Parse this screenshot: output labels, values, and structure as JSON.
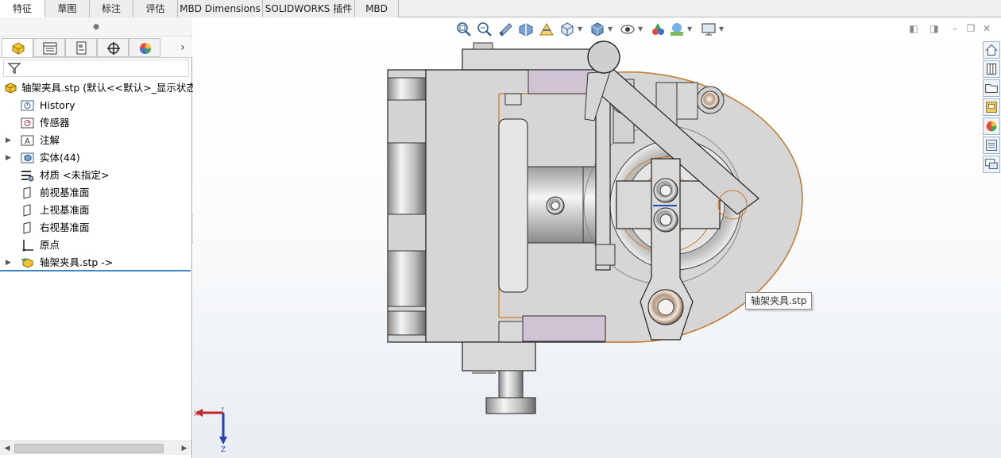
{
  "tabs": [
    {
      "label": "特征",
      "active": true
    },
    {
      "label": "草图",
      "active": false
    },
    {
      "label": "标注",
      "active": false
    },
    {
      "label": "评估",
      "active": false
    },
    {
      "label": "MBD Dimensions",
      "active": false
    },
    {
      "label": "SOLIDWORKS 插件",
      "active": false
    },
    {
      "label": "MBD",
      "active": false
    }
  ],
  "feature_tree": {
    "root": {
      "label": "轴架夹具.stp  (默认<<默认>_显示状态",
      "icon": "part-icon"
    },
    "items": [
      {
        "label": "History",
        "icon": "history-icon",
        "expandable": false
      },
      {
        "label": "传感器",
        "icon": "sensor-icon",
        "expandable": false
      },
      {
        "label": "注解",
        "icon": "annotation-icon",
        "expandable": true
      },
      {
        "label": "实体(44)",
        "icon": "solid-bodies-icon",
        "expandable": true
      },
      {
        "label": "材质 <未指定>",
        "icon": "material-icon",
        "expandable": false
      },
      {
        "label": "前视基准面",
        "icon": "plane-icon",
        "expandable": false
      },
      {
        "label": "上视基准面",
        "icon": "plane-icon",
        "expandable": false
      },
      {
        "label": "右视基准面",
        "icon": "plane-icon",
        "expandable": false
      },
      {
        "label": "原点",
        "icon": "origin-icon",
        "expandable": false
      },
      {
        "label": "轴架夹具.stp ->",
        "icon": "imported-feature-icon",
        "expandable": true
      }
    ]
  },
  "tooltip": {
    "text": "轴架夹具.stp"
  },
  "triad": {
    "x_label": "X",
    "z_label": "Z",
    "y_label": "Y"
  },
  "colors": {
    "accent": "#3a85c8",
    "selection_edge": "#d2791f",
    "model_fill": "#d9d9d9",
    "triad_x": "#c0262b",
    "triad_z": "#2a3fb0"
  }
}
